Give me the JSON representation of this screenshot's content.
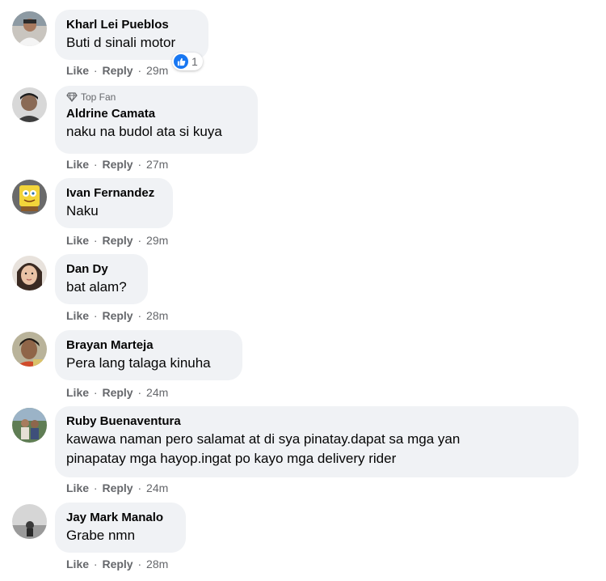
{
  "comments": [
    {
      "author": "Kharl Lei Pueblos",
      "text": "Buti d sinali motor",
      "like": "Like",
      "reply": "Reply",
      "time": "29m",
      "reaction_count": "1",
      "top_fan": ""
    },
    {
      "author": "Aldrine Camata",
      "text": "naku na budol ata si kuya",
      "like": "Like",
      "reply": "Reply",
      "time": "27m",
      "top_fan": "Top Fan"
    },
    {
      "author": "Ivan Fernandez",
      "text": "Naku",
      "like": "Like",
      "reply": "Reply",
      "time": "29m"
    },
    {
      "author": "Dan Dy",
      "text": "bat alam?",
      "like": "Like",
      "reply": "Reply",
      "time": "28m"
    },
    {
      "author": "Brayan Marteja",
      "text": "Pera lang talaga kinuha",
      "like": "Like",
      "reply": "Reply",
      "time": "24m"
    },
    {
      "author": "Ruby Buenaventura",
      "text_line1": "kawawa naman pero salamat at di sya pinatay.dapat sa mga yan",
      "text_line2": "pinapatay mga hayop.ingat po kayo mga delivery rider",
      "like": "Like",
      "reply": "Reply",
      "time": "24m"
    },
    {
      "author": "Jay Mark Manalo",
      "text": "Grabe nmn",
      "like": "Like",
      "reply": "Reply",
      "time": "28m"
    }
  ],
  "separator": "·",
  "icons": {
    "top_fan": "diamond-icon",
    "reaction": "thumbs-up-icon"
  },
  "colors": {
    "bubble": "#f0f2f5",
    "meta": "#65676b",
    "like_blue": "#1877f2"
  }
}
